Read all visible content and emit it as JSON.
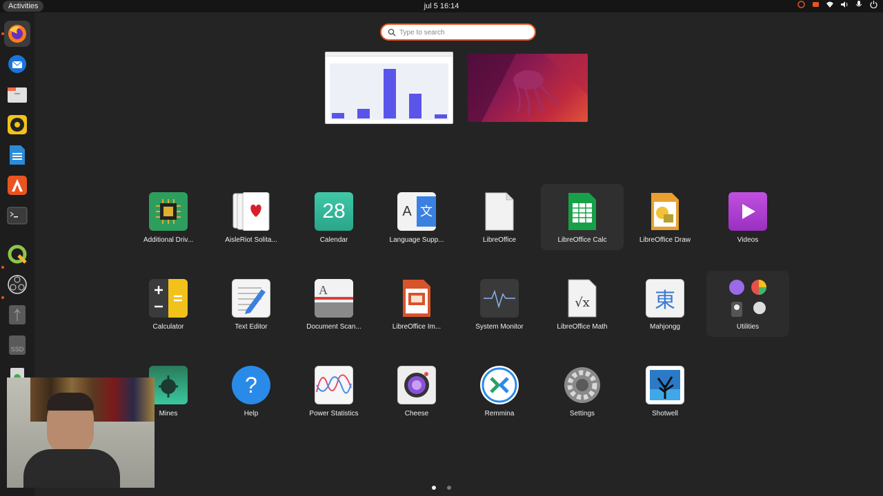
{
  "topbar": {
    "activities": "Activities",
    "clock": "jul 5  16:14",
    "tray_icons": [
      "ubuntu-pro-icon",
      "screen-share-icon",
      "wifi-icon",
      "volume-icon",
      "microphone-icon",
      "power-icon"
    ]
  },
  "dock": {
    "items": [
      {
        "name": "firefox",
        "icon": "firefox-icon",
        "active": true,
        "running": true
      },
      {
        "name": "thunderbird",
        "icon": "thunderbird-icon",
        "active": false,
        "running": false
      },
      {
        "name": "files",
        "icon": "files-icon",
        "active": false,
        "running": false
      },
      {
        "name": "rhythmbox",
        "icon": "rhythmbox-icon",
        "active": false,
        "running": false
      },
      {
        "name": "libreoffice-writer",
        "icon": "writer-icon",
        "active": false,
        "running": false
      },
      {
        "name": "app-center",
        "icon": "app-center-icon",
        "active": false,
        "running": false
      },
      {
        "name": "terminal",
        "icon": "terminal-icon",
        "active": false,
        "running": false
      },
      {
        "name": "qgis",
        "icon": "qgis-icon",
        "active": false,
        "running": true
      },
      {
        "name": "obs",
        "icon": "obs-icon",
        "active": false,
        "running": true
      },
      {
        "name": "usb-drive",
        "icon": "usb-icon",
        "active": false,
        "running": false
      },
      {
        "name": "ssd-drive",
        "icon": "ssd-icon",
        "label": "SSD",
        "active": false,
        "running": false
      },
      {
        "name": "trash",
        "icon": "trash-icon",
        "active": false,
        "running": false
      }
    ]
  },
  "search": {
    "placeholder": "Type to search",
    "value": ""
  },
  "workspaces": [
    {
      "name": "workspace-1",
      "chart_bars": [
        0.08,
        0.15,
        0.75,
        0.38,
        0.06
      ]
    },
    {
      "name": "workspace-2"
    }
  ],
  "apps": [
    {
      "label": "Additional Driv...",
      "icon": "chip-icon"
    },
    {
      "label": "AisleRiot Solita...",
      "icon": "cards-icon"
    },
    {
      "label": "Calendar",
      "icon": "calendar-icon",
      "day": "28"
    },
    {
      "label": "Language Supp...",
      "icon": "language-icon",
      "glyph_a": "A",
      "glyph_b": "文"
    },
    {
      "label": "LibreOffice",
      "icon": "libreoffice-icon"
    },
    {
      "label": "LibreOffice Calc",
      "icon": "calc-icon"
    },
    {
      "label": "LibreOffice Draw",
      "icon": "draw-icon"
    },
    {
      "label": "Videos",
      "icon": "videos-icon"
    },
    {
      "label": "Calculator",
      "icon": "calculator-icon"
    },
    {
      "label": "Text Editor",
      "icon": "text-editor-icon"
    },
    {
      "label": "Document Scan...",
      "icon": "scanner-icon",
      "glyph": "A"
    },
    {
      "label": "LibreOffice Im...",
      "icon": "impress-icon"
    },
    {
      "label": "System Monitor",
      "icon": "system-monitor-icon"
    },
    {
      "label": "LibreOffice Math",
      "icon": "math-icon",
      "glyph": "√x"
    },
    {
      "label": "Mahjongg",
      "icon": "mahjongg-icon",
      "glyph": "東"
    },
    {
      "label": "Utilities",
      "icon": "utilities-folder-icon"
    },
    {
      "label": "Mines",
      "icon": "mines-icon"
    },
    {
      "label": "Help",
      "icon": "help-icon",
      "glyph": "?"
    },
    {
      "label": "Power Statistics",
      "icon": "power-statistics-icon"
    },
    {
      "label": "Cheese",
      "icon": "cheese-icon"
    },
    {
      "label": "Remmina",
      "icon": "remmina-icon"
    },
    {
      "label": "Settings",
      "icon": "settings-icon"
    },
    {
      "label": "Shotwell",
      "icon": "shotwell-icon"
    }
  ],
  "pager": {
    "pages": 2,
    "current": 1
  },
  "colors": {
    "accent": "#e95420",
    "background": "#242424",
    "dock": "#1d1d1d"
  }
}
